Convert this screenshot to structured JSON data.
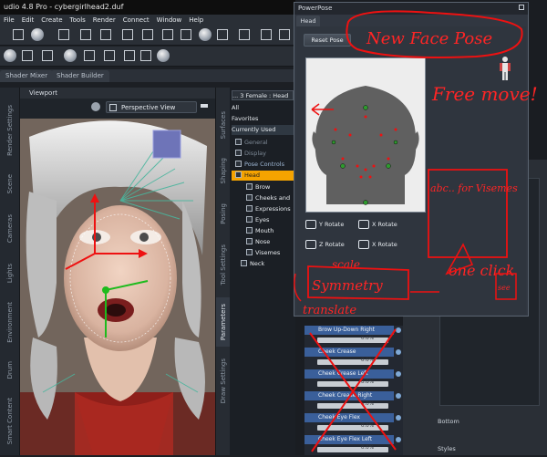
{
  "window": {
    "title": "udio 4.8 Pro - cybergirlhead2.duf"
  },
  "menu": [
    "File",
    "Edit",
    "Create",
    "Tools",
    "Render",
    "Connect",
    "Window",
    "Help"
  ],
  "pane_tabs": [
    "Shader Mixer",
    "Shader Builder"
  ],
  "viewport": {
    "tab": "Viewport",
    "view": "Perspective View"
  },
  "left_tabs": [
    "Render Settings",
    "Scene",
    "Cameras",
    "Lights",
    "Environment",
    "Drum",
    "Smart Content"
  ],
  "right_tabs": [
    "Surfaces",
    "Shaping",
    "Posing",
    "Tool Settings",
    "Parameters",
    "Draw Settings"
  ],
  "params": {
    "header": "... 3 Female : Head",
    "filters": [
      "All",
      "Favorites",
      "Currently Used"
    ],
    "groups": [
      {
        "label": "General",
        "indent": 1,
        "dim": true
      },
      {
        "label": "Display",
        "indent": 1,
        "dim": true
      },
      {
        "label": "Pose Controls",
        "indent": 1,
        "dim": false
      },
      {
        "label": "Head",
        "indent": 2,
        "selected": true
      },
      {
        "label": "Brow",
        "indent": 3
      },
      {
        "label": "Cheeks and",
        "indent": 3
      },
      {
        "label": "Expressions",
        "indent": 3
      },
      {
        "label": "Eyes",
        "indent": 3
      },
      {
        "label": "Mouth",
        "indent": 3
      },
      {
        "label": "Nose",
        "indent": 3
      },
      {
        "label": "Visemes",
        "indent": 3
      },
      {
        "label": "Neck",
        "indent": 2
      }
    ]
  },
  "powerpose": {
    "title": "PowerPose",
    "tab": "Head",
    "reset": "Reset Pose",
    "rotations": [
      "Y Rotate",
      "X Rotate",
      "Z Rotate",
      "X Rotate"
    ]
  },
  "param_list": [
    {
      "label": "Brow Up-Down Right",
      "value": "0.0%"
    },
    {
      "label": "Cheek Crease",
      "value": "0.0%"
    },
    {
      "label": "Cheek Crease Left",
      "value": "0.0%"
    },
    {
      "label": "Cheek Crease Right",
      "value": "0.0%"
    },
    {
      "label": "Cheek Eye Flex",
      "value": "0.0%"
    },
    {
      "label": "Cheek Eye Flex Left",
      "value": "0.0%"
    }
  ],
  "side": {
    "bottom": "Bottom",
    "styles": "Styles"
  },
  "annotations": [
    "New Face Pose",
    "Free move!",
    "abc.. for Visemes",
    "one click",
    "see",
    "scale",
    "Symmetry",
    "translate"
  ],
  "colors": {
    "annotation": "#ee1111",
    "selected": "#f5a300",
    "accent": "#3a5f9a"
  }
}
